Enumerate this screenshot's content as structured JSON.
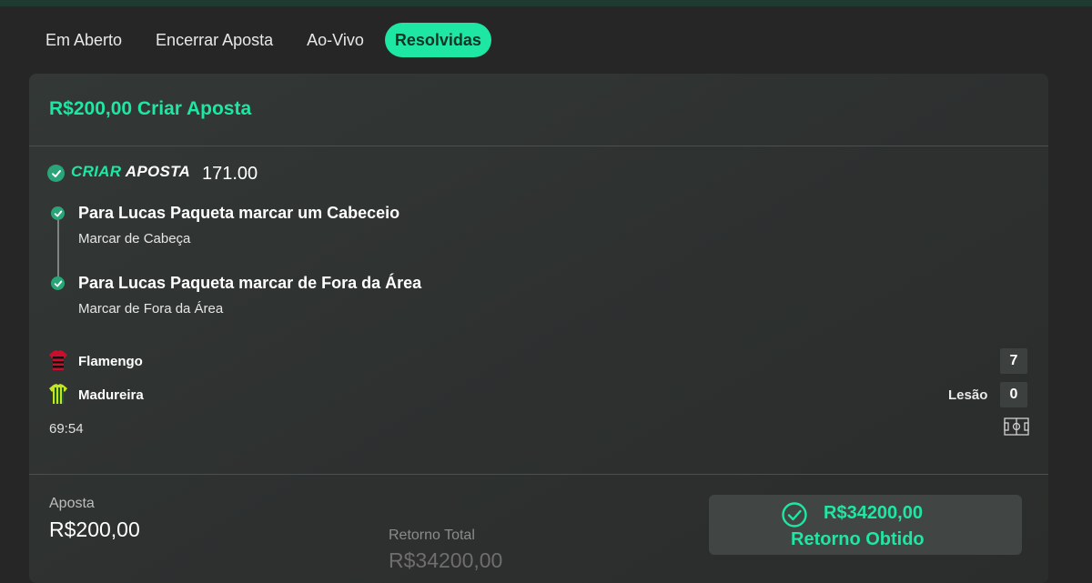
{
  "tabs": [
    {
      "label": "Em Aberto",
      "active": false
    },
    {
      "label": "Encerrar Aposta",
      "active": false
    },
    {
      "label": "Ao-Vivo",
      "active": false
    },
    {
      "label": "Resolvidas",
      "active": true
    }
  ],
  "bet": {
    "title": "R$200,00 Criar Aposta",
    "logo_part1": "CRIAR",
    "logo_part2": "APOSTA",
    "odds": "171.00",
    "selections": [
      {
        "title": "Para Lucas Paqueta marcar um Cabeceio",
        "subtitle": "Marcar de Cabeça"
      },
      {
        "title": "Para Lucas Paqueta marcar de Fora da Área",
        "subtitle": "Marcar de Fora da Área"
      }
    ],
    "match": {
      "home": {
        "name": "Flamengo",
        "score": "7"
      },
      "away": {
        "name": "Madureira",
        "score": "0",
        "note": "Lesão"
      },
      "time": "69:54"
    },
    "stake_label": "Aposta",
    "stake_value": "R$200,00",
    "return_label": "Retorno Total",
    "return_value": "R$34200,00",
    "result_amount": "R$34200,00",
    "result_label": "Retorno Obtido"
  },
  "colors": {
    "accent": "#1ee6a3",
    "check": "#2aa57a",
    "background": "#262626",
    "card": "#313534"
  },
  "icons": [
    "check-circle-icon",
    "flamengo-jersey-icon",
    "madureira-jersey-icon",
    "pitch-icon",
    "check-outline-icon"
  ]
}
